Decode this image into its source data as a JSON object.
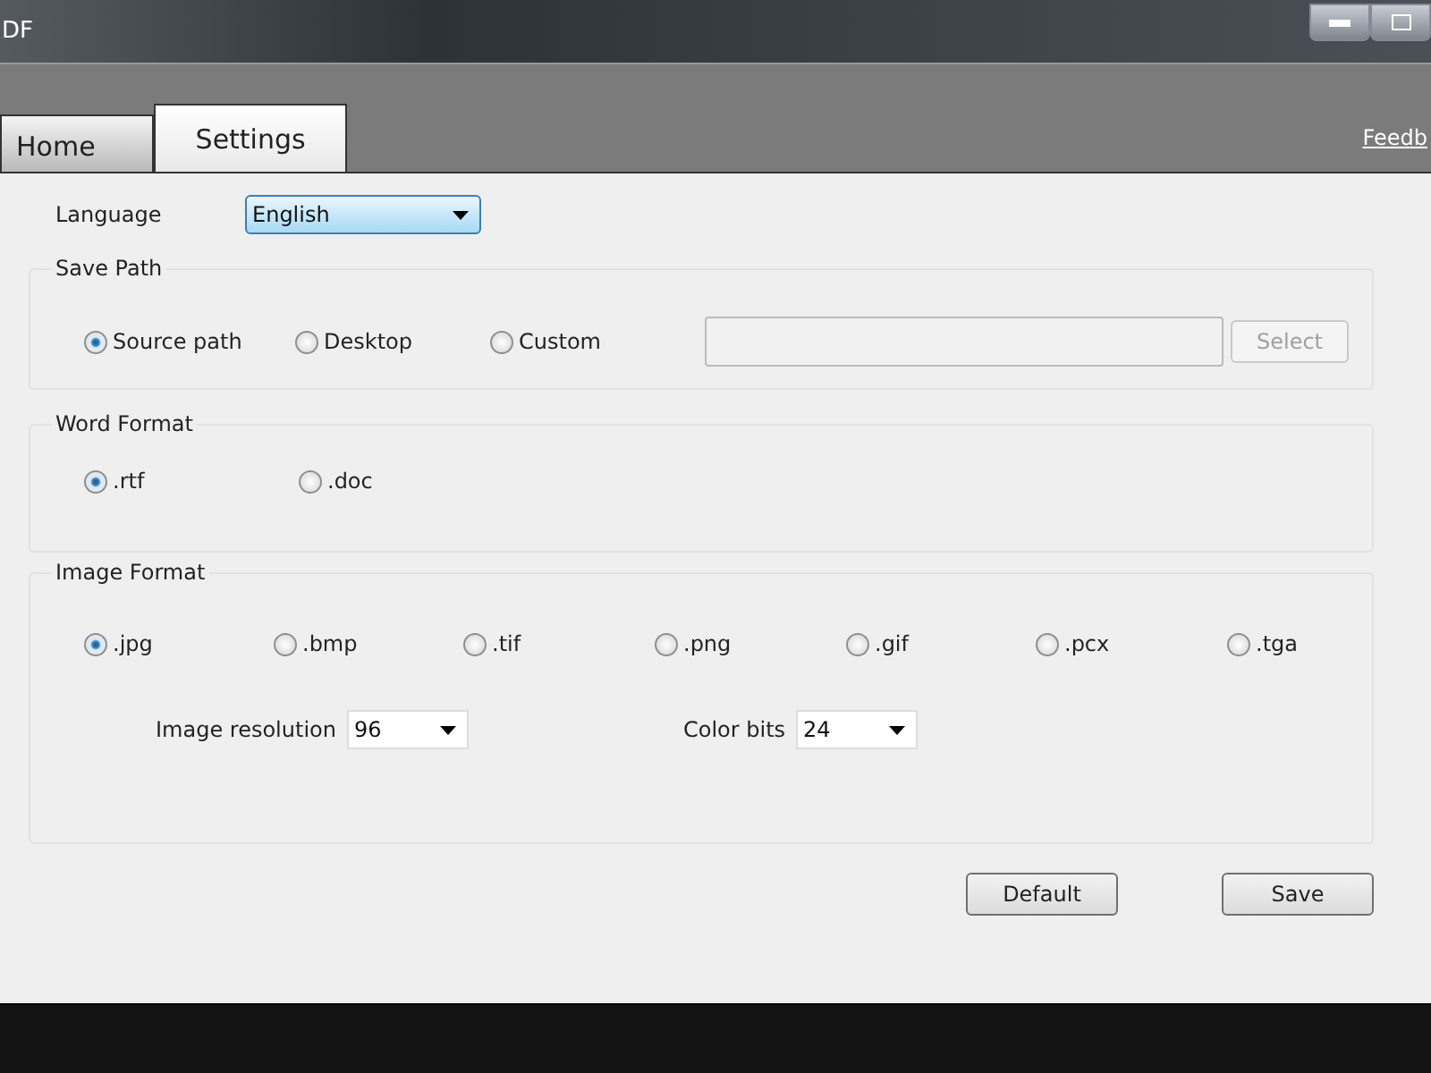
{
  "window": {
    "title": "DF"
  },
  "tabs": [
    {
      "label": "Home",
      "selected": false
    },
    {
      "label": "Settings",
      "selected": true
    }
  ],
  "feedback_link": "Feedb",
  "language": {
    "label": "Language",
    "value": "English"
  },
  "save_path": {
    "legend": "Save Path",
    "options": [
      {
        "label": "Source path",
        "selected": true
      },
      {
        "label": "Desktop",
        "selected": false
      },
      {
        "label": "Custom",
        "selected": false
      }
    ],
    "path_field": {
      "disabled": true
    },
    "select_button": {
      "label": "Select",
      "disabled": true
    }
  },
  "word_format": {
    "legend": "Word Format",
    "options": [
      {
        "label": ".rtf",
        "selected": true
      },
      {
        "label": ".doc",
        "selected": false
      }
    ]
  },
  "image_format": {
    "legend": "Image Format",
    "options": [
      {
        "label": ".jpg",
        "selected": true
      },
      {
        "label": ".bmp",
        "selected": false
      },
      {
        "label": ".tif",
        "selected": false
      },
      {
        "label": ".png",
        "selected": false
      },
      {
        "label": ".gif",
        "selected": false
      },
      {
        "label": ".pcx",
        "selected": false
      },
      {
        "label": ".tga",
        "selected": false
      }
    ],
    "resolution": {
      "label": "Image resolution",
      "value": "96"
    },
    "color_bits": {
      "label": "Color bits",
      "value": "24"
    }
  },
  "buttons": [
    "Default",
    "Save"
  ]
}
